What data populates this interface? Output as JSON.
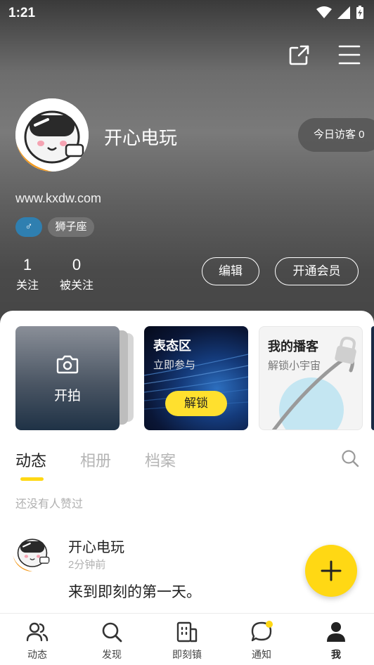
{
  "status_bar": {
    "time": "1:21"
  },
  "profile": {
    "name": "开心电玩",
    "visitors": "今日访客 0",
    "website": "www.kxdw.com",
    "gender_symbol": "♂",
    "zodiac": "狮子座",
    "following_count": "1",
    "following_label": "关注",
    "followers_count": "0",
    "followers_label": "被关注",
    "edit_label": "编辑",
    "vip_label": "开通会员"
  },
  "cards": {
    "shoot_label": "开拍",
    "attitude_title": "表态区",
    "attitude_sub": "立即参与",
    "attitude_button": "解锁",
    "podcast_title": "我的播客",
    "podcast_sub": "解锁小宇宙"
  },
  "tabs": [
    {
      "label": "动态",
      "active": true
    },
    {
      "label": "相册",
      "active": false
    },
    {
      "label": "档案",
      "active": false
    }
  ],
  "feed": {
    "no_likes": "还没有人赞过",
    "post": {
      "author": "开心电玩",
      "time": "2分钟前",
      "text": "来到即刻的第一天。"
    }
  },
  "bottom_nav": [
    {
      "label": "动态",
      "icon": "people-icon"
    },
    {
      "label": "发现",
      "icon": "search-icon"
    },
    {
      "label": "即刻镇",
      "icon": "building-icon"
    },
    {
      "label": "通知",
      "icon": "chat-bubble-icon"
    },
    {
      "label": "我",
      "icon": "person-icon"
    }
  ],
  "colors": {
    "accent": "#ffd814",
    "gender_tag": "#2f7fb0"
  }
}
